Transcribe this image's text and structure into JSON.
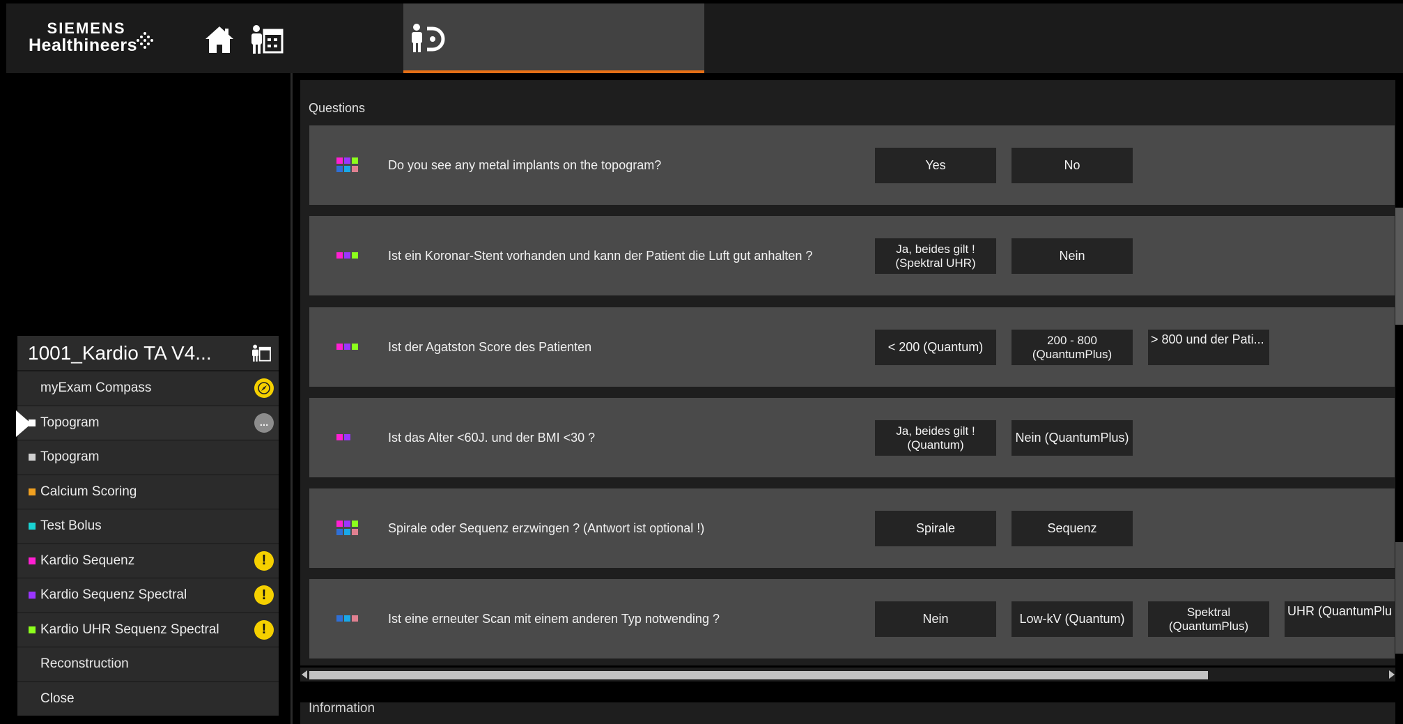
{
  "header": {
    "brand_line1": "SIEMENS",
    "brand_line2": "Healthineers",
    "icons": [
      "home-icon",
      "patient-schedule-icon",
      "patient-exam-icon"
    ],
    "accent_color": "#e46f16"
  },
  "workflow": {
    "title": "1001_Kardio TA V4...",
    "items": [
      {
        "label": "myExam Compass",
        "color": "",
        "badge": "compass"
      },
      {
        "label": "Topogram",
        "color": "#ffffff",
        "badge": "more",
        "current": true
      },
      {
        "label": "Topogram",
        "color": "#cfcfcf",
        "badge": ""
      },
      {
        "label": "Calcium Scoring",
        "color": "#f0a020",
        "badge": ""
      },
      {
        "label": "Test Bolus",
        "color": "#19d3d3",
        "badge": ""
      },
      {
        "label": "Kardio Sequenz",
        "color": "#ff1fd2",
        "badge": "warning"
      },
      {
        "label": "Kardio Sequenz Spectral",
        "color": "#9b35ff",
        "badge": "warning"
      },
      {
        "label": "Kardio UHR Sequenz Spectral",
        "color": "#8cff1c",
        "badge": "warning"
      },
      {
        "label": "Reconstruction",
        "color": "",
        "badge": ""
      },
      {
        "label": "Close",
        "color": "",
        "badge": ""
      }
    ],
    "warning_glyph": "!",
    "more_glyph": "..."
  },
  "questions": {
    "title": "Questions",
    "rows": [
      {
        "text": "Do you see any metal implants on the topogram?",
        "answers": [
          "Yes",
          "No"
        ]
      },
      {
        "text": "Ist ein Koronar-Stent vorhanden und kann der Patient die Luft gut anhalten ?",
        "answers": [
          "Ja, beides gilt ! (Spektral UHR)",
          "Nein"
        ]
      },
      {
        "text": "Ist der Agatston Score des Patienten",
        "answers": [
          "< 200 (Quantum)",
          "200 - 800 (QuantumPlus)",
          "> 800 und der Pati..."
        ]
      },
      {
        "text": "Ist das Alter <60J. und der BMI <30 ?",
        "answers": [
          "Ja, beides gilt ! (Quantum)",
          "Nein (QuantumPlus)"
        ]
      },
      {
        "text": "Spirale oder Sequenz erzwingen ? (Antwort ist optional !)",
        "answers": [
          "Spirale",
          "Sequenz"
        ]
      },
      {
        "text": "Ist eine erneuter Scan mit einem anderen Typ notwending ?",
        "answers": [
          "Nein",
          "Low-kV (Quantum)",
          "Spektral (QuantumPlus)",
          "UHR (QuantumPlu"
        ]
      }
    ]
  },
  "information": {
    "title": "Information"
  }
}
